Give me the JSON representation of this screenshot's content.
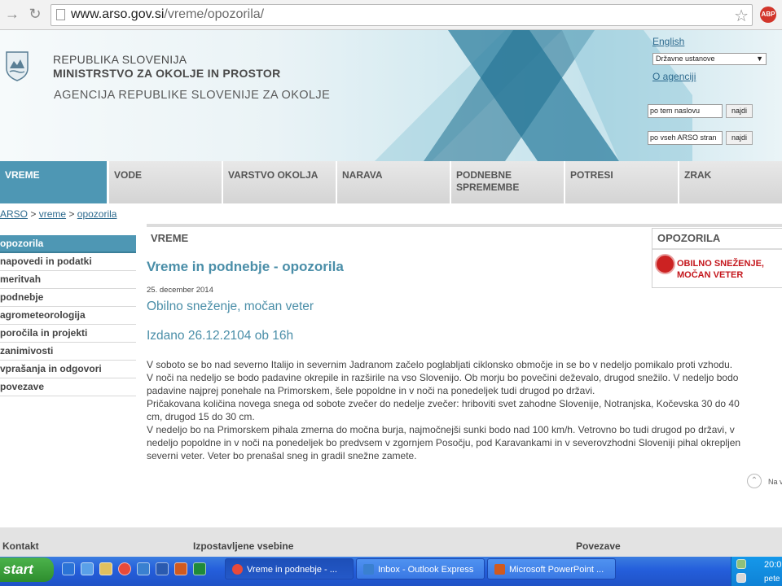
{
  "browser": {
    "url_host": "www.arso.gov.si",
    "url_path": "/vreme/opozorila/",
    "abp_label": "ABP"
  },
  "header": {
    "line1": "REPUBLIKA SLOVENIJA",
    "line2": "MINISTRSTVO ZA OKOLJE IN PROSTOR",
    "line3": "AGENCIJA REPUBLIKE SLOVENIJE ZA OKOLJE",
    "language_link": "English",
    "institutions_select": "Državne ustanove",
    "about_link": "O agenciji",
    "search_page_placeholder": "po tem naslovu",
    "search_all_placeholder": "po vseh ARSO stran",
    "search_button": "najdi"
  },
  "nav": {
    "tabs": [
      {
        "label": "VREME"
      },
      {
        "label": "VODE"
      },
      {
        "label": "VARSTVO OKOLJA"
      },
      {
        "label": "NARAVA"
      },
      {
        "label": "PODNEBNE SPREMEMBE"
      },
      {
        "label": "POTRESI"
      },
      {
        "label": "ZRAK"
      }
    ]
  },
  "breadcrumb": {
    "root": "ARSO",
    "sep": ">",
    "level1": "vreme",
    "level2": "opozorila"
  },
  "sidebar": {
    "items": [
      {
        "label": "opozorila"
      },
      {
        "label": "napovedi in podatki"
      },
      {
        "label": "meritvah"
      },
      {
        "label": "podnebje"
      },
      {
        "label": "agrometeorologija"
      },
      {
        "label": "poročila in projekti"
      },
      {
        "label": "zanimivosti"
      },
      {
        "label": "vprašanja in odgovori"
      },
      {
        "label": "povezave"
      }
    ]
  },
  "content": {
    "section_label": "VREME",
    "page_title": "Vreme in podnebje - opozorila",
    "date": "25. december 2014",
    "headline": "Obilno sneženje, močan veter",
    "issued": "Izdano 26.12.2104 ob 16h",
    "body_lines": [
      "V soboto se bo nad severno Italijo in severnim Jadranom začelo poglabljati ciklonsko območje in se bo v nedeljo pomikalo proti vzhodu.",
      "V noči na nedeljo se bodo padavine okrepile in razširile na vso Slovenijo. Ob morju bo povečini deževalo, drugod snežilo. V nedeljo bodo",
      "padavine najprej ponehale na Primorskem, šele popoldne in v noči na ponedeljek tudi drugod po državi.",
      "Pričakovana količina novega snega od sobote zvečer do nedelje zvečer: hriboviti svet zahodne Slovenije, Notranjska, Kočevska 30 do 40",
      "cm, drugod 15 do 30 cm.",
      "V nedeljo bo na Primorskem pihala zmerna do močna burja, najmočnejši sunki bodo nad 100 km/h. Vetrovno bo tudi drugod po državi, v",
      "nedeljo popoldne in v noči na ponedeljek bo predvsem v zgornjem Posočju, pod Karavankami in v severovzhodni Sloveniji pihal okrepljen",
      "severni veter. Veter bo prenašal sneg in gradil snežne zamete."
    ],
    "to_top_label": "Na vrh"
  },
  "warnings": {
    "title": "OPOZORILA",
    "item_line1": "OBILNO SNEŽENJE,",
    "item_line2": "MOČAN VETER",
    "color": "#c4161c"
  },
  "footer": {
    "col1": "Kontakt",
    "col2": "Izpostavljene vsebine",
    "col3": "Povezave"
  },
  "taskbar": {
    "start_label": "start",
    "tasks": [
      {
        "label": "Vreme in podnebje - ..."
      },
      {
        "label": "Inbox - Outlook Express"
      },
      {
        "label": "Microsoft PowerPoint ..."
      }
    ],
    "clock": "20:0",
    "user": "pete"
  },
  "colors": {
    "accent": "#4e97b4",
    "title_blue": "#4a8ea8",
    "link": "#2d6a8e"
  }
}
